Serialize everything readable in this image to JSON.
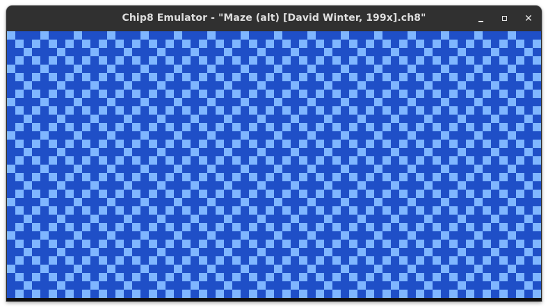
{
  "window": {
    "title": "Chip8 Emulator - \"Maze (alt) [David Winter, 199x].ch8\"",
    "buttons": {
      "minimize": "minimize-icon",
      "maximize": "maximize-icon",
      "close": "close-icon",
      "close_glyph": "✕"
    }
  },
  "display": {
    "columns": 64,
    "rows": 32,
    "colors": {
      "background": "#1f4fc7",
      "pixel_on": "#7fb6ff"
    },
    "pattern": "diamond-maze"
  }
}
